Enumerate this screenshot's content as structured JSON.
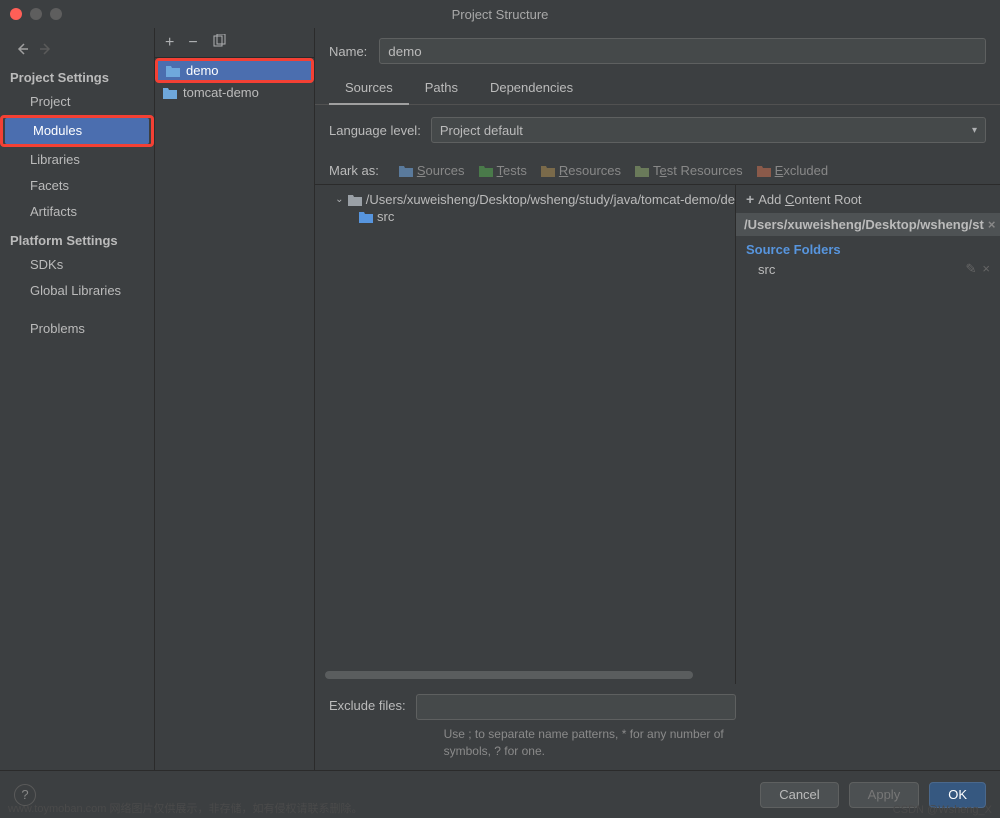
{
  "window": {
    "title": "Project Structure"
  },
  "sidebar": {
    "project_settings_label": "Project Settings",
    "platform_settings_label": "Platform Settings",
    "items": {
      "project": "Project",
      "modules": "Modules",
      "libraries": "Libraries",
      "facets": "Facets",
      "artifacts": "Artifacts",
      "sdks": "SDKs",
      "global_libraries": "Global Libraries",
      "problems": "Problems"
    }
  },
  "modules": {
    "items": [
      {
        "name": "demo",
        "selected": true
      },
      {
        "name": "tomcat-demo",
        "selected": false
      }
    ]
  },
  "detail": {
    "name_label": "Name:",
    "name_value": "demo",
    "tabs": {
      "sources": "Sources",
      "paths": "Paths",
      "dependencies": "Dependencies"
    },
    "lang_label": "Language level:",
    "lang_value": "Project default",
    "markas": {
      "label": "Mark as:",
      "sources": "Sources",
      "tests": "Tests",
      "resources": "Resources",
      "test_resources": "Test Resources",
      "excluded": "Excluded"
    },
    "tree": {
      "root": "/Users/xuweisheng/Desktop/wsheng/study/java/tomcat-demo/de",
      "child": "src"
    },
    "content_panel": {
      "add_content_root": "Add Content Root",
      "root_path": "/Users/xuweisheng/Desktop/wsheng/st",
      "source_folders_label": "Source Folders",
      "source_folders": [
        "src"
      ]
    },
    "exclude": {
      "label": "Exclude files:",
      "hint": "Use ; to separate name patterns, * for any number of symbols, ? for one."
    }
  },
  "footer": {
    "cancel": "Cancel",
    "apply": "Apply",
    "ok": "OK"
  },
  "watermark": {
    "left": "www.toymoban.com 网络图片仅供展示，非存储，如有侵权请联系删除。",
    "right": "CSDN @Wsheng_X"
  }
}
